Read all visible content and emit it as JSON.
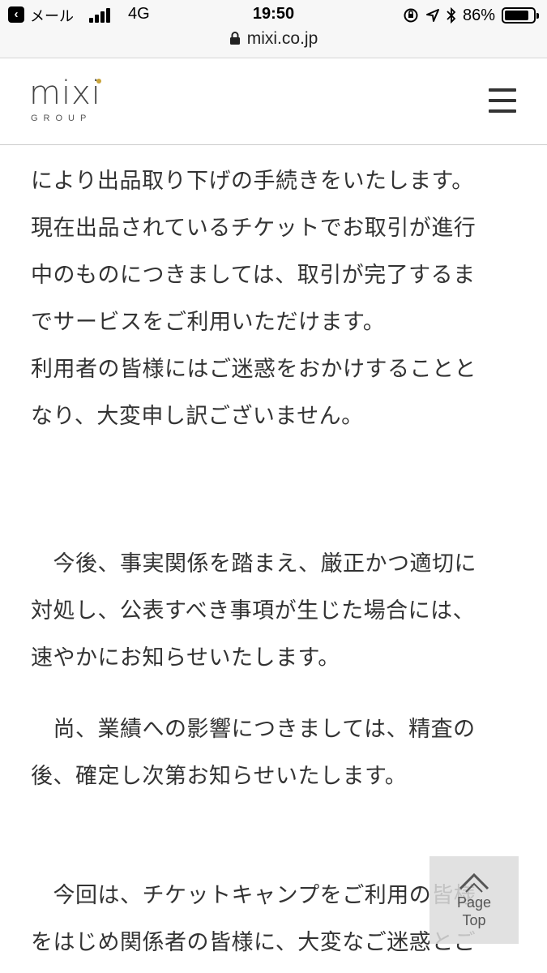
{
  "status_bar": {
    "back_app": "メール",
    "network": "4G",
    "time": "19:50",
    "battery": "86%",
    "battery_level": 0.86,
    "url": "mixi.co.jp"
  },
  "header": {
    "logo_word": "mixi",
    "logo_sub": "GROUP",
    "logo_accent_color": "#c9a43a"
  },
  "article": {
    "paragraphs": [
      "により出品取り下げの手続きをいたします。\n現在出品されているチケットでお取引が進行\n中のものにつきましては、取引が完了するま\nでサービスをご利用いただけます。\n利用者の皆様にはご迷惑をおかけすることと\nなり、大変申し訳ございません。",
      "　今後、事実関係を踏まえ、厳正かつ適切に\n対処し、公表すべき事項が生じた場合には、\n速やかにお知らせいたします。",
      "　尚、業績への影響につきましては、精査の\n後、確定し次第お知らせいたします。",
      "　今回は、チケットキャンプをご利用の皆様\nをはじめ関係者の皆様に、大変なご迷惑とご"
    ]
  },
  "page_top": {
    "label": "Page\nTop"
  }
}
